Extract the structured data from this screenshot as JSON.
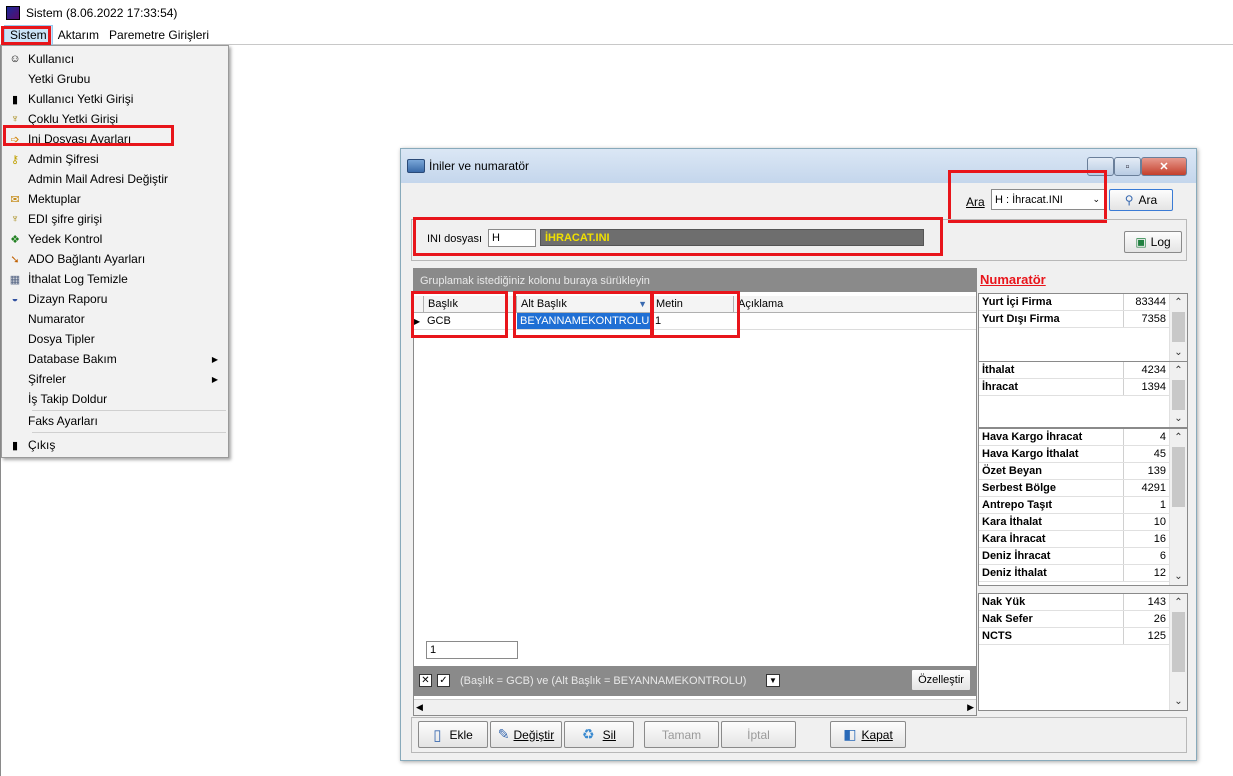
{
  "window": {
    "title": "Sistem (8.06.2022 17:33:54)"
  },
  "menubar": [
    "Sistem",
    "Aktarım",
    "Paremetre Girişleri"
  ],
  "dropdown": [
    {
      "label": "Kullanıcı",
      "icon": "user-icon"
    },
    {
      "label": "Yetki Grubu",
      "icon": ""
    },
    {
      "label": "Kullanıcı Yetki Girişi",
      "icon": "door-icon"
    },
    {
      "label": "Çoklu Yetki Girişi",
      "icon": "keys-icon"
    },
    {
      "label": "Ini Dosyası  Ayarları",
      "icon": "arrow-icon"
    },
    {
      "label": "Admin Şifresi",
      "icon": "key-icon"
    },
    {
      "label": "Admin Mail Adresi Değiştir",
      "icon": ""
    },
    {
      "label": "Mektuplar",
      "icon": "letter-icon"
    },
    {
      "label": "EDI şifre girişi",
      "icon": "keys-icon"
    },
    {
      "label": "Yedek Kontrol",
      "icon": "backup-icon"
    },
    {
      "label": "ADO Bağlantı Ayarları",
      "icon": "wand-icon"
    },
    {
      "label": "İthalat Log Temizle",
      "icon": "broom-icon"
    },
    {
      "label": "Dizayn Raporu",
      "icon": "report-icon"
    },
    {
      "label": "Numarator",
      "icon": ""
    },
    {
      "label": "Dosya Tipler",
      "icon": ""
    },
    {
      "label": "Database Bakım",
      "icon": "",
      "submenu": true
    },
    {
      "label": "Şifreler",
      "icon": "",
      "submenu": true
    },
    {
      "label": "İş Takip Doldur",
      "icon": ""
    },
    {
      "label": "Faks Ayarları",
      "icon": ""
    },
    {
      "label": "Çıkış",
      "icon": "door-icon"
    }
  ],
  "dialog": {
    "title": "İniler ve numaratör",
    "search_label": "Ara",
    "search_value": "H : İhracat.INI",
    "search_button": "Ara",
    "ini_label": "INI dosyası",
    "ini_code": "H",
    "ini_name": "İHRACAT.INI",
    "log_button": "Log",
    "group_hint": "Gruplamak istediğiniz kolonu buraya sürükleyin",
    "columns": [
      "Başlık",
      "Alt Başlık",
      "Metin",
      "Açıklama"
    ],
    "rows": [
      {
        "baslik": "GCB",
        "alt_baslik": "BEYANNAMEKONTROLU",
        "metin": "1",
        "aciklama": ""
      }
    ],
    "footer_count": "1",
    "filter_text": "(Başlık = GCB) ve (Alt Başlık = BEYANNAMEKONTROLU)",
    "customize_button": "Özelleştir",
    "buttons": {
      "add": "Ekle",
      "edit": "Değiştir",
      "delete": "Sil",
      "ok": "Tamam",
      "cancel": "İptal",
      "close": "Kapat"
    },
    "numarator_title": "Numaratör",
    "numarator_groups": [
      [
        {
          "name": "Yurt İçi Firma",
          "value": "83344"
        },
        {
          "name": "Yurt Dışı Firma",
          "value": "7358"
        }
      ],
      [
        {
          "name": "İthalat",
          "value": "4234"
        },
        {
          "name": "İhracat",
          "value": "1394"
        }
      ],
      [
        {
          "name": "Hava Kargo İhracat",
          "value": "4"
        },
        {
          "name": "Hava Kargo İthalat",
          "value": "45"
        },
        {
          "name": "Özet Beyan",
          "value": "139"
        },
        {
          "name": "Serbest Bölge",
          "value": "4291"
        },
        {
          "name": "Antrepo Taşıt",
          "value": "1"
        },
        {
          "name": "Kara İthalat",
          "value": "10"
        },
        {
          "name": "Kara İhracat",
          "value": "16"
        },
        {
          "name": "Deniz İhracat",
          "value": "6"
        },
        {
          "name": "Deniz İthalat",
          "value": "12"
        }
      ],
      [
        {
          "name": "Nak Yük",
          "value": "143"
        },
        {
          "name": "Nak Sefer",
          "value": "26"
        },
        {
          "name": "NCTS",
          "value": "125"
        }
      ]
    ]
  },
  "colors": {
    "highlight": "#e8151b",
    "selection": "#1f6fd4",
    "ini_bar": "#6e6e6e",
    "ini_text": "#f0e000"
  }
}
